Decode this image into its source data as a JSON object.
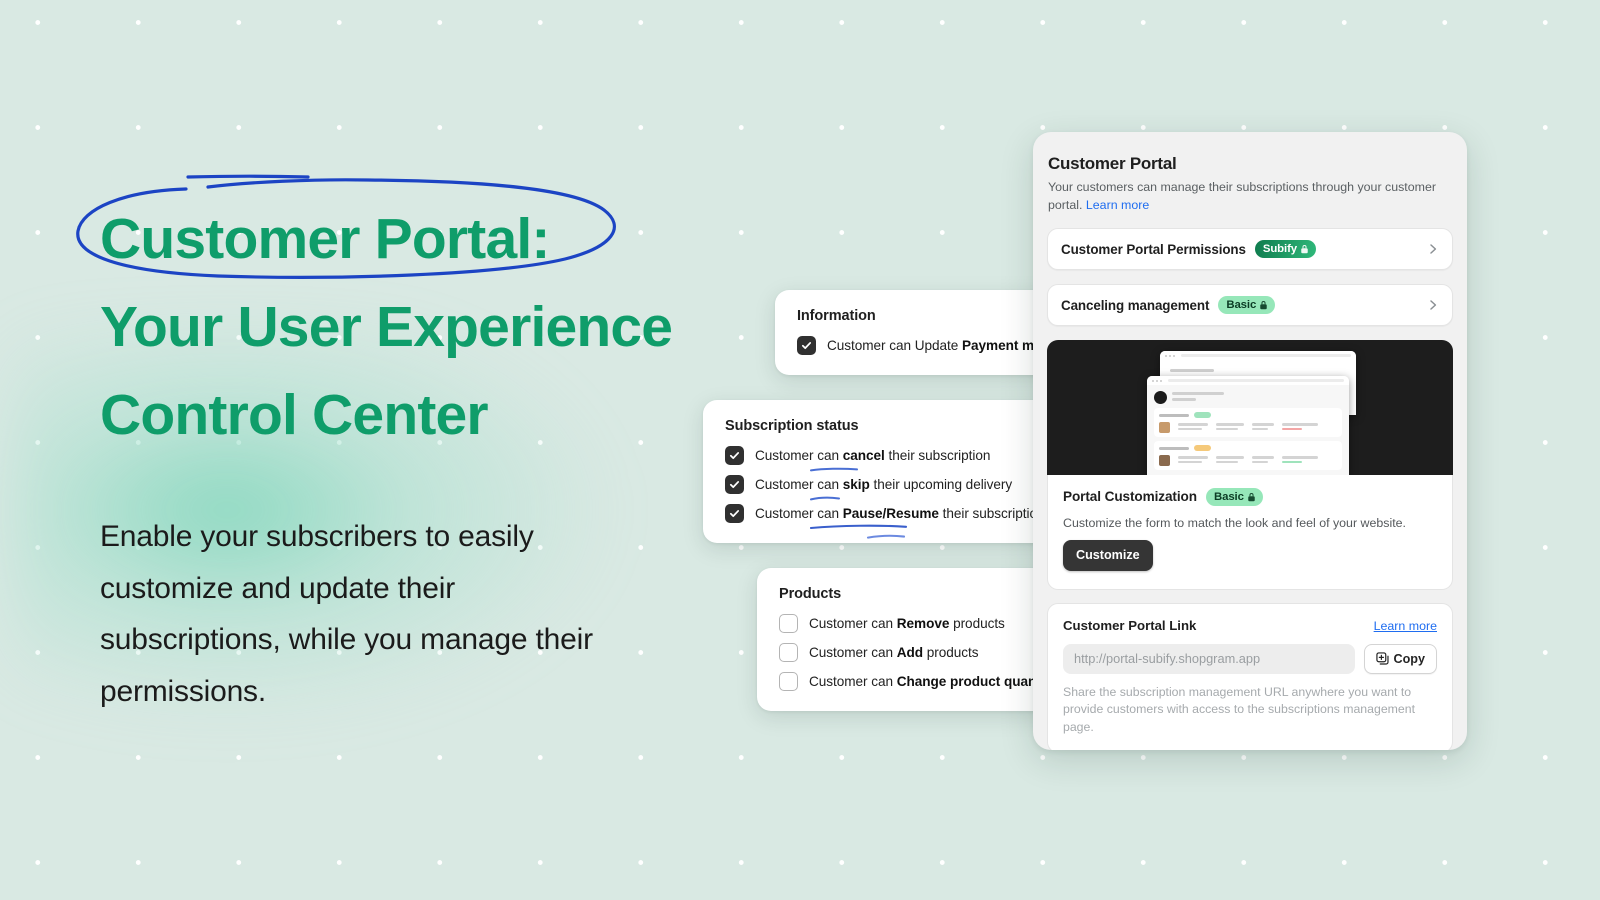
{
  "hero": {
    "headline_line1": "Customer Portal:",
    "headline_line2": "Your User Experience",
    "headline_line3": "Control Center",
    "body": "Enable your subscribers to easily customize and update their subscriptions, while you manage their permissions.",
    "accent_green": "#0f9d6a",
    "annotation_blue": "#1c44c4",
    "background": "#d9e9e3"
  },
  "cards": {
    "information": {
      "title": "Information",
      "rows": [
        {
          "prefix": "Customer can Update ",
          "strong": "Payment method",
          "suffix": "",
          "checked": true
        }
      ]
    },
    "subscription_status": {
      "title": "Subscription status",
      "rows": [
        {
          "prefix": "Customer can ",
          "strong": "cancel",
          "suffix": " their subscription",
          "checked": true
        },
        {
          "prefix": "Customer can ",
          "strong": "skip",
          "suffix": " their upcoming delivery",
          "checked": true
        },
        {
          "prefix": "Customer can ",
          "strong": "Pause/Resume",
          "suffix": " their subscription renew",
          "checked": true
        }
      ]
    },
    "products": {
      "title": "Products",
      "rows": [
        {
          "prefix": "Customer can ",
          "strong": "Remove",
          "suffix": " products",
          "checked": false
        },
        {
          "prefix": "Customer can ",
          "strong": "Add",
          "suffix": " products",
          "checked": false
        },
        {
          "prefix": "Customer can ",
          "strong": "Change product quantity",
          "suffix": "",
          "checked": false
        }
      ]
    }
  },
  "panel": {
    "title": "Customer Portal",
    "subtitle_text": "Your customers can manage their subscriptions through your customer portal. ",
    "subtitle_link": "Learn more",
    "rows": [
      {
        "label": "Customer Portal Permissions",
        "badge": "Subify",
        "badge_style": "subify"
      },
      {
        "label": "Canceling management",
        "badge": "Basic",
        "badge_style": "basic"
      }
    ],
    "customization": {
      "title": "Portal Customization",
      "badge": "Basic",
      "description": "Customize the form to match the look and feel of your website.",
      "button": "Customize"
    },
    "portal_link": {
      "title": "Customer Portal Link",
      "learn_more": "Learn more",
      "input_value": "http://portal-subify.shopgram.app",
      "copy_button": "Copy",
      "note": "Share the subscription management URL anywhere you want to provide customers with access to the subscriptions management page."
    }
  }
}
